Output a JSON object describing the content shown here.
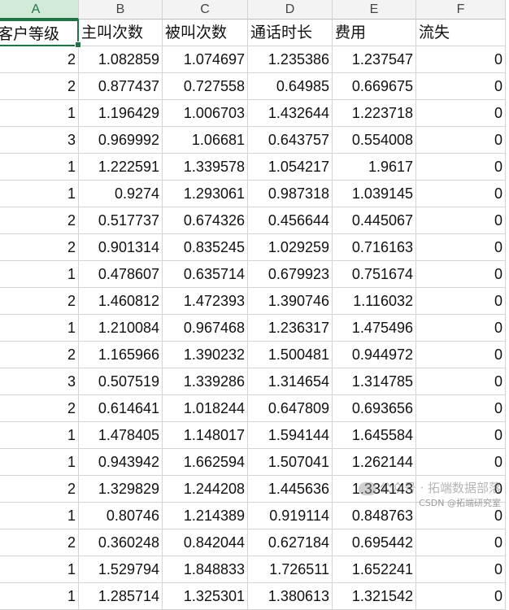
{
  "columns": [
    "A",
    "B",
    "C",
    "D",
    "E",
    "F"
  ],
  "headers": [
    "客户等级",
    "主叫次数",
    "被叫次数",
    "通话时长",
    "费用",
    "流失"
  ],
  "rows": [
    [
      "2",
      "1.082859",
      "1.074697",
      "1.235386",
      "1.237547",
      "0"
    ],
    [
      "2",
      "0.877437",
      "0.727558",
      "0.64985",
      "0.669675",
      "0"
    ],
    [
      "1",
      "1.196429",
      "1.006703",
      "1.432644",
      "1.223718",
      "0"
    ],
    [
      "3",
      "0.969992",
      "1.06681",
      "0.643757",
      "0.554008",
      "0"
    ],
    [
      "1",
      "1.222591",
      "1.339578",
      "1.054217",
      "1.9617",
      "0"
    ],
    [
      "1",
      "0.9274",
      "1.293061",
      "0.987318",
      "1.039145",
      "0"
    ],
    [
      "2",
      "0.517737",
      "0.674326",
      "0.456644",
      "0.445067",
      "0"
    ],
    [
      "2",
      "0.901314",
      "0.835245",
      "1.029259",
      "0.716163",
      "0"
    ],
    [
      "1",
      "0.478607",
      "0.635714",
      "0.679923",
      "0.751674",
      "0"
    ],
    [
      "2",
      "1.460812",
      "1.472393",
      "1.390746",
      "1.116032",
      "0"
    ],
    [
      "1",
      "1.210084",
      "0.967468",
      "1.236317",
      "1.475496",
      "0"
    ],
    [
      "2",
      "1.165966",
      "1.390232",
      "1.500481",
      "0.944972",
      "0"
    ],
    [
      "3",
      "0.507519",
      "1.339286",
      "1.314654",
      "1.314785",
      "0"
    ],
    [
      "2",
      "0.614641",
      "1.018244",
      "0.647809",
      "0.693656",
      "0"
    ],
    [
      "1",
      "1.478405",
      "1.148017",
      "1.594144",
      "1.645584",
      "0"
    ],
    [
      "1",
      "0.943942",
      "1.662594",
      "1.507041",
      "1.262144",
      "0"
    ],
    [
      "2",
      "1.329829",
      "1.244208",
      "1.445636",
      "1.334143",
      "0"
    ],
    [
      "1",
      "0.80746",
      "1.214389",
      "0.919114",
      "0.848763",
      "0"
    ],
    [
      "2",
      "0.360248",
      "0.842044",
      "0.627184",
      "0.695442",
      "0"
    ],
    [
      "1",
      "1.529794",
      "1.848833",
      "1.726511",
      "1.652241",
      "0"
    ],
    [
      "1",
      "1.285714",
      "1.325301",
      "1.380613",
      "1.321542",
      "0"
    ]
  ],
  "watermark": {
    "line1": "公众号 · 拓端数据部落",
    "line2": "CSDN @拓端研究室"
  }
}
